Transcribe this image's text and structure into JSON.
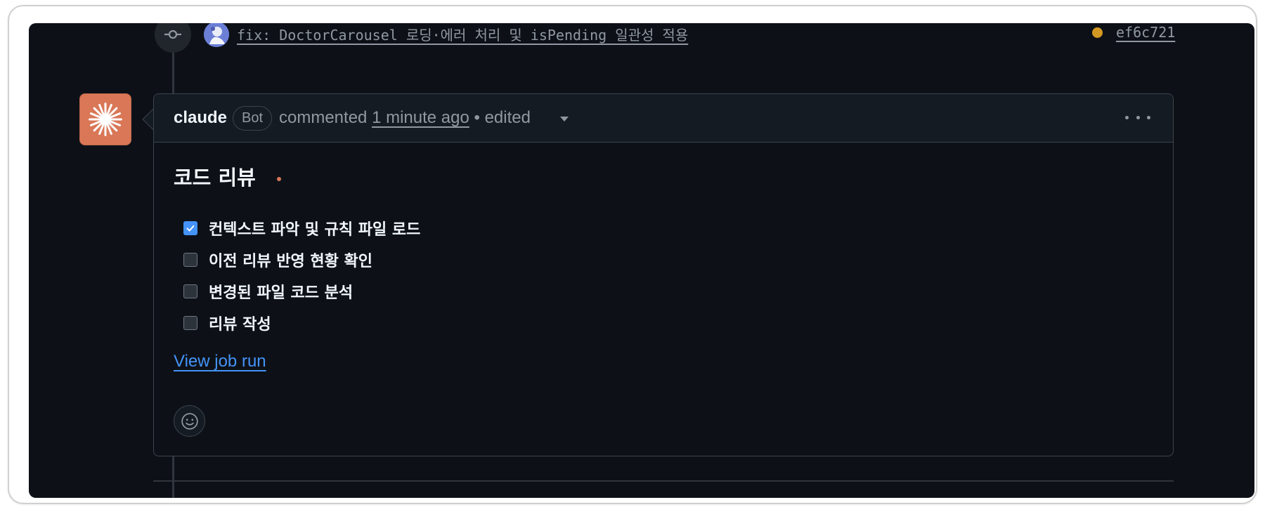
{
  "commit": {
    "message": "fix: DoctorCarousel 로딩·에러 처리 및 isPending 일관성 적용",
    "sha": "ef6c721",
    "status_color": "#d29922",
    "node_icon": "git-commit-icon",
    "avatar_icon": "user-avatar-icon"
  },
  "comment": {
    "author": "claude",
    "badge": "Bot",
    "action": "commented",
    "time": "1 minute ago",
    "edited": "• edited",
    "avatar_icon": "claude-sparkle-icon",
    "menu_icon": "kebab-horizontal-icon",
    "title": "코드 리뷰",
    "tasks": [
      {
        "label": "컨텍스트 파악 및 규칙 파일 로드",
        "checked": true
      },
      {
        "label": "이전 리뷰 반영 현황 확인",
        "checked": false
      },
      {
        "label": "변경된 파일 코드 분석",
        "checked": false
      },
      {
        "label": "리뷰 작성",
        "checked": false
      }
    ],
    "link": "View job run",
    "reaction_icon": "smiley-icon"
  },
  "colors": {
    "background": "#0d1117",
    "accent_link": "#4493f8",
    "claude_brand": "#d97757"
  }
}
